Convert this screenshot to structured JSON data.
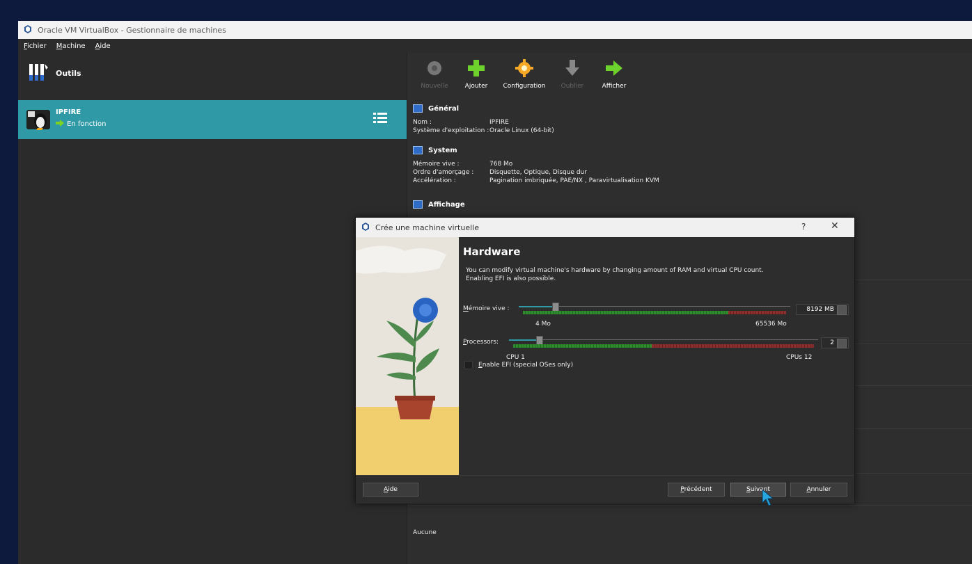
{
  "window": {
    "title": "Oracle VM VirtualBox - Gestionnaire de machines",
    "menu": [
      "Fichier",
      "Machine",
      "Aide"
    ]
  },
  "left": {
    "tools_label": "Outils",
    "vm": {
      "name": "IPFIRE",
      "state": "En fonction"
    }
  },
  "toolbar": {
    "new": "Nouvelle",
    "add": "Ajouter",
    "settings": "Configuration",
    "discard": "Oublier",
    "show": "Afficher"
  },
  "details": {
    "general": {
      "title": "Général",
      "rows": [
        {
          "k": "Nom :",
          "v": "IPFIRE"
        },
        {
          "k": "Système d'exploitation :",
          "v": "Oracle Linux (64-bit)"
        }
      ]
    },
    "system": {
      "title": "System",
      "rows": [
        {
          "k": "Mémoire vive :",
          "v": "768 Mo"
        },
        {
          "k": "Ordre d'amorçage :",
          "v": "Disquette, Optique, Disque dur"
        },
        {
          "k": "Accélération :",
          "v": "Pagination imbriquée, PAE/NX , Paravirtualisation KVM"
        }
      ]
    },
    "display": {
      "title": "Affichage"
    },
    "bottom_value": "Aucune"
  },
  "dialog": {
    "title": "Crée une machine virtuelle",
    "help_glyph": "?",
    "close_glyph": "✕",
    "heading": "Hardware",
    "description_line1": "You can modify virtual machine's hardware by changing amount of RAM and virtual CPU count.",
    "description_line2": "Enabling EFI is also possible.",
    "memory": {
      "label": "Mémoire vive :",
      "value": "8192 MB",
      "min": "4 Mo",
      "max": "65536 Mo",
      "fraction": 0.125
    },
    "cpu": {
      "label": "Processors:",
      "value": "2",
      "min": "CPU 1",
      "max": "CPUs 12",
      "fraction": 0.09
    },
    "efi_label": "Enable EFI (special OSes only)",
    "buttons": {
      "help": "Aide",
      "back": "Précédent",
      "next": "Suivant",
      "cancel": "Annuler"
    }
  },
  "colors": {
    "accent": "#2f9aa5",
    "gauge_green": "#2e8b2e",
    "gauge_red": "#8b2e2e"
  }
}
